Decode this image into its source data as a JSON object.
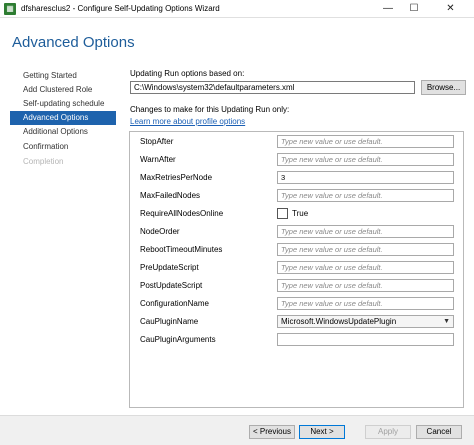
{
  "window": {
    "title": "dfsharesclus2 - Configure Self-Updating Options Wizard",
    "icon": "cluster-icon",
    "minimize_glyph": "—",
    "maximize_glyph": "☐",
    "close_glyph": "✕"
  },
  "header": {
    "title": "Advanced Options"
  },
  "nav": {
    "items": [
      {
        "label": "Getting Started",
        "state": "normal"
      },
      {
        "label": "Add Clustered Role",
        "state": "normal"
      },
      {
        "label": "Self-updating schedule",
        "state": "normal"
      },
      {
        "label": "Advanced Options",
        "state": "active"
      },
      {
        "label": "Additional Options",
        "state": "normal"
      },
      {
        "label": "Confirmation",
        "state": "normal"
      },
      {
        "label": "Completion",
        "state": "disabled"
      }
    ]
  },
  "main": {
    "options_label": "Updating Run options based on:",
    "options_path": "C:\\Windows\\system32\\defaultparameters.xml",
    "browse_label": "Browse...",
    "changes_label": "Changes to make for this Updating Run only:",
    "learn_more_link": "Learn more about profile options",
    "placeholder": "Type new value or use default.",
    "params": [
      {
        "name": "StopAfter",
        "kind": "text",
        "value": ""
      },
      {
        "name": "WarnAfter",
        "kind": "text",
        "value": ""
      },
      {
        "name": "MaxRetriesPerNode",
        "kind": "text",
        "value": "3"
      },
      {
        "name": "MaxFailedNodes",
        "kind": "text",
        "value": ""
      },
      {
        "name": "RequireAllNodesOnline",
        "kind": "checkbox",
        "value": "True",
        "checked": false
      },
      {
        "name": "NodeOrder",
        "kind": "text",
        "value": ""
      },
      {
        "name": "RebootTimeoutMinutes",
        "kind": "text",
        "value": ""
      },
      {
        "name": "PreUpdateScript",
        "kind": "text",
        "value": ""
      },
      {
        "name": "PostUpdateScript",
        "kind": "text",
        "value": ""
      },
      {
        "name": "ConfigurationName",
        "kind": "text",
        "value": ""
      },
      {
        "name": "CauPluginName",
        "kind": "select",
        "value": "Microsoft.WindowsUpdatePlugin"
      },
      {
        "name": "CauPluginArguments",
        "kind": "empty",
        "value": ""
      }
    ]
  },
  "footer": {
    "previous_label": "< Previous",
    "next_label": "Next >",
    "apply_label": "Apply",
    "cancel_label": "Cancel"
  },
  "colors": {
    "accent": "#1e63ad",
    "title": "#1e5d9a",
    "link": "#1a5fb4"
  }
}
